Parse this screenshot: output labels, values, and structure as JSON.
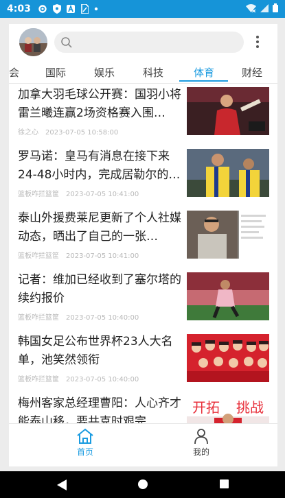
{
  "status": {
    "time": "4:03"
  },
  "tabs": [
    "会",
    "国际",
    "娱乐",
    "科技",
    "体育",
    "财经"
  ],
  "active_tab": "体育",
  "news": [
    {
      "title": "加拿大羽毛球公开赛：国羽小将雷兰曦连赢2场资格赛入围…",
      "source": "徐之心",
      "date": "2023-07-05 10:58:00"
    },
    {
      "title": "罗马诺：皇马有消息在接下来24-48小时内，完成居勒尔的…",
      "source": "篮板咋拦篮筐",
      "date": "2023-07-05 10:41:00"
    },
    {
      "title": "泰山外援费莱尼更新了个人社媒动态，晒出了自己的一张…",
      "source": "篮板咋拦篮筐",
      "date": "2023-07-05 10:41:00"
    },
    {
      "title": "记者：维加已经收到了塞尔塔的续约报价",
      "source": "篮板咋拦篮筐",
      "date": "2023-07-05 10:40:00"
    },
    {
      "title": "韩国女足公布世界杯23人大名单，池笑然领衔",
      "source": "篮板咋拦篮筐",
      "date": "2023-07-05 10:40:00"
    },
    {
      "title": "梅州客家总经理曹阳：人心齐才能泰山移，要共克时艰完…",
      "source": "",
      "date": ""
    }
  ],
  "thumbs": [
    "开拓",
    "挑战"
  ],
  "bottom_nav": {
    "home": "首页",
    "mine": "我的"
  },
  "colors": {
    "accent": "#1a9be0",
    "statusbar": "#1694d8"
  }
}
